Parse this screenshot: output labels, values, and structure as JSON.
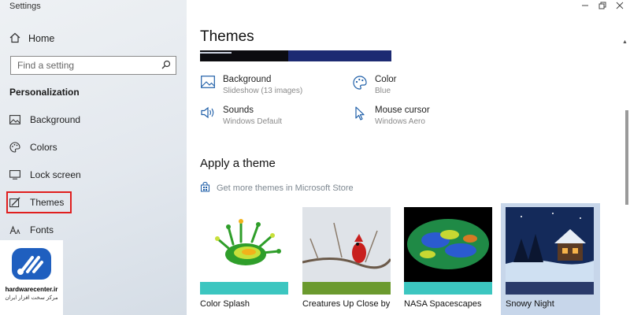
{
  "window": {
    "title": "Settings"
  },
  "sidebar": {
    "home_label": "Home",
    "search_placeholder": "Find a setting",
    "section_title": "Personalization",
    "items": [
      {
        "label": "Background",
        "icon": "image-icon"
      },
      {
        "label": "Colors",
        "icon": "palette-icon"
      },
      {
        "label": "Lock screen",
        "icon": "monitor-icon"
      },
      {
        "label": "Themes",
        "icon": "brush-icon",
        "highlighted": true
      },
      {
        "label": "Fonts",
        "icon": "font-icon"
      }
    ]
  },
  "logo": {
    "name": "hardwarecenter.ir",
    "subtitle": "مرکز سخت افزار ایران"
  },
  "main": {
    "title": "Themes",
    "properties": [
      {
        "label": "Background",
        "value": "Slideshow (13 images)",
        "icon": "image-icon"
      },
      {
        "label": "Color",
        "value": "Blue",
        "icon": "palette-icon"
      },
      {
        "label": "Sounds",
        "value": "Windows Default",
        "icon": "speaker-icon"
      },
      {
        "label": "Mouse cursor",
        "value": "Windows Aero",
        "icon": "cursor-icon"
      }
    ],
    "apply_title": "Apply a theme",
    "store_link": "Get more themes in Microsoft Store",
    "themes": [
      {
        "name": "Color Splash",
        "bar_color": "#3cc6c0"
      },
      {
        "name": "Creatures Up Close by",
        "bar_color": "#6b9a2e"
      },
      {
        "name": "NASA Spacescapes",
        "bar_color": "#3cc6c0"
      },
      {
        "name": "Snowy Night",
        "bar_color": "#2a3a6a",
        "selected": true
      }
    ]
  },
  "colors": {
    "accent": "#0078d7",
    "highlight_frame": "#e01e1e",
    "selected_tile": "#c7d6ea"
  }
}
